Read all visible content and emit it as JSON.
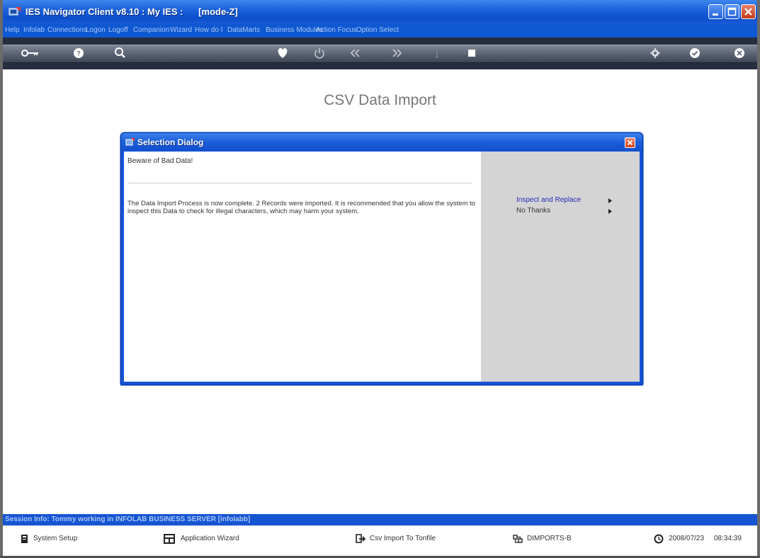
{
  "window": {
    "title": "IES Navigator Client v8.10 : My IES :      [mode-Z]"
  },
  "menu": {
    "items": [
      "Help",
      "Infolab",
      "Connections",
      "Logon",
      "Logoff",
      "Companion",
      "Wizard",
      "How do I",
      "DataMarts",
      "Business Modules",
      "Action Focus",
      "Option Select"
    ]
  },
  "toolbar": {
    "icons": [
      "key-icon",
      "help-icon",
      "search-icon",
      "heart-icon",
      "power-icon",
      "rewind-icon",
      "forward-icon",
      "info-icon",
      "stop-icon",
      "gear-icon",
      "checkmark-icon",
      "close-icon"
    ]
  },
  "main": {
    "page_title": "CSV Data Import"
  },
  "dialog": {
    "title": "Selection Dialog",
    "heading": "Beware of Bad Data!",
    "message": "The Data Import Process is now complete. 2 Records were imported. It is recommended that you allow the system to inspect this Data to check for illegal characters, which may harm your system.",
    "options": [
      {
        "label": "Inspect and Replace",
        "color": "#2727b8"
      },
      {
        "label": "No Thanks",
        "color": "#333333"
      }
    ]
  },
  "status": {
    "session": "Session Info: Tommy working in INFOLAB BUSINESS SERVER  [infolabb]"
  },
  "taskbar": {
    "system_setup": "System Setup",
    "application_wizard": "Application Wizard",
    "csv_import": "Csv Import To Tonfile",
    "dimports": "DIMPORTS-B",
    "date": "2008/07/23",
    "time": "08:34:39"
  },
  "colors": {
    "titlebar": "#1c61d9",
    "menubar": "#0e58d2",
    "toolbar": "#252d3f",
    "dialog_option_active": "#2727b8",
    "dialog_right_panel": "#d4d4d4"
  }
}
